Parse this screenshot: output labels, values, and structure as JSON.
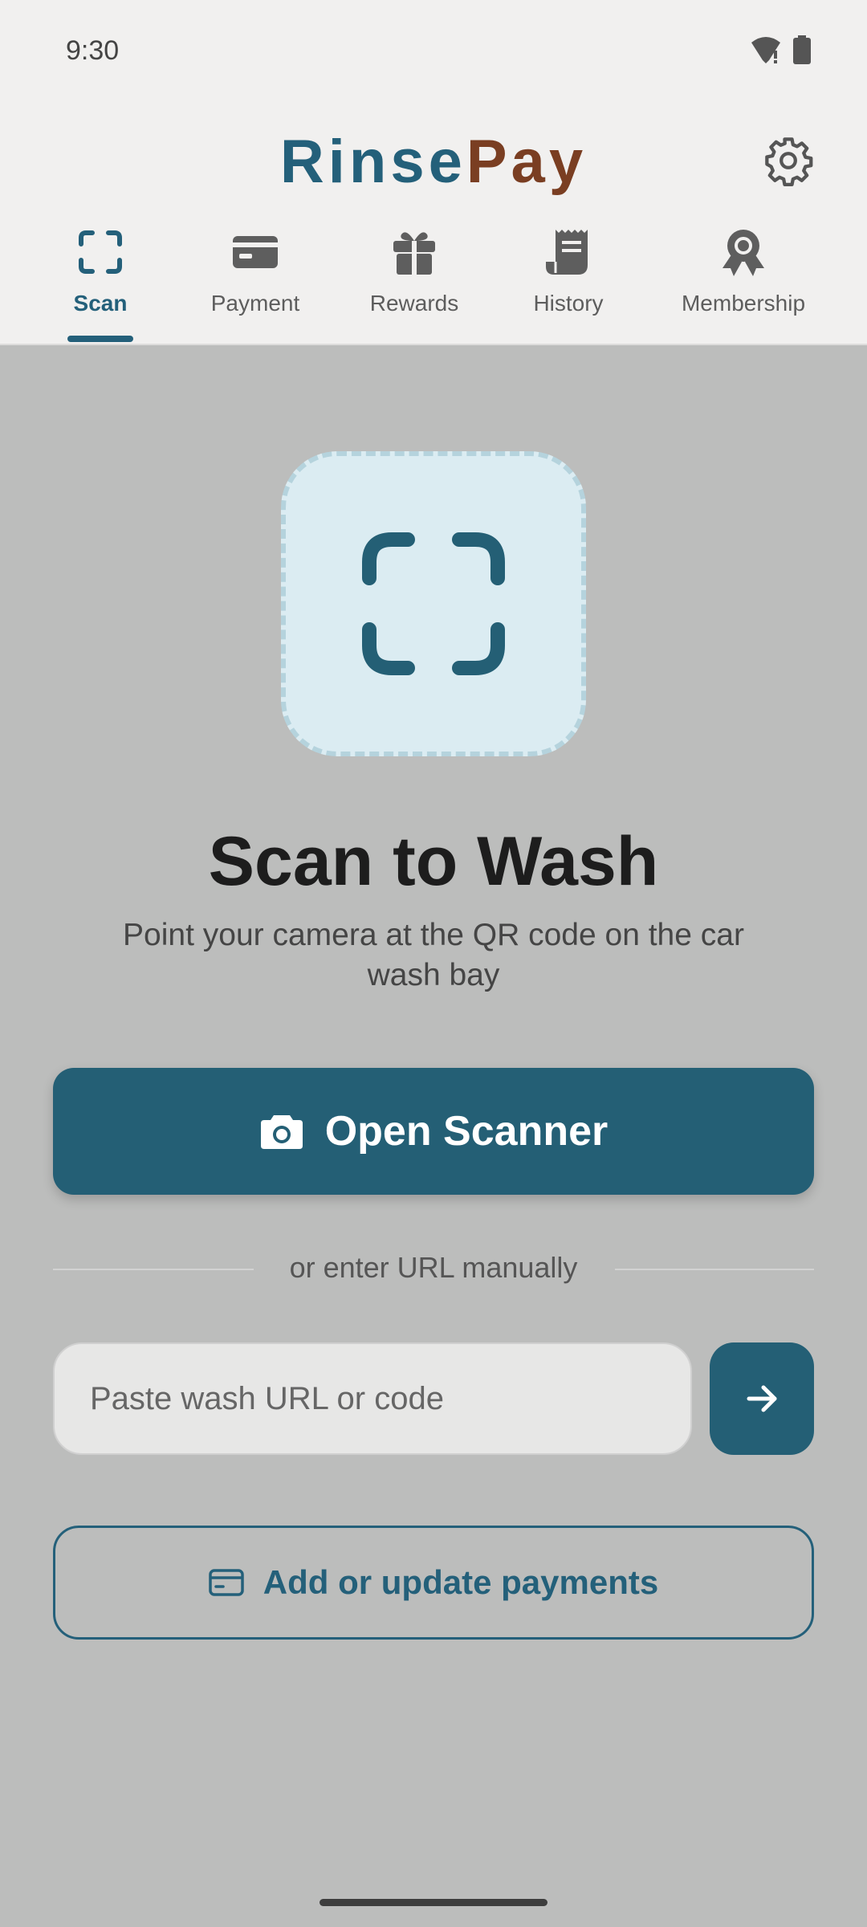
{
  "status_bar": {
    "time": "9:30"
  },
  "header": {
    "brand_part1": "Rinse",
    "brand_part2": "Pay",
    "settings_icon": "gear-icon"
  },
  "tabs": [
    {
      "label": "Scan",
      "icon": "scan-icon",
      "active": true
    },
    {
      "label": "Payment",
      "icon": "card-icon",
      "active": false
    },
    {
      "label": "Rewards",
      "icon": "gift-icon",
      "active": false
    },
    {
      "label": "History",
      "icon": "receipt-icon",
      "active": false
    },
    {
      "label": "Membership",
      "icon": "badge-icon",
      "active": false
    }
  ],
  "main": {
    "title": "Scan to Wash",
    "subtitle": "Point your camera at the QR code on the car wash bay",
    "open_scanner_label": "Open Scanner",
    "divider_text": "or enter URL manually",
    "url_placeholder": "Paste wash URL or code",
    "url_value": "",
    "payments_button_label": "Add or update payments"
  },
  "colors": {
    "primary": "#245f75",
    "brand_accent": "#7a3e22",
    "background": "#bcbdbc",
    "header_bg": "#f1f0ef"
  }
}
